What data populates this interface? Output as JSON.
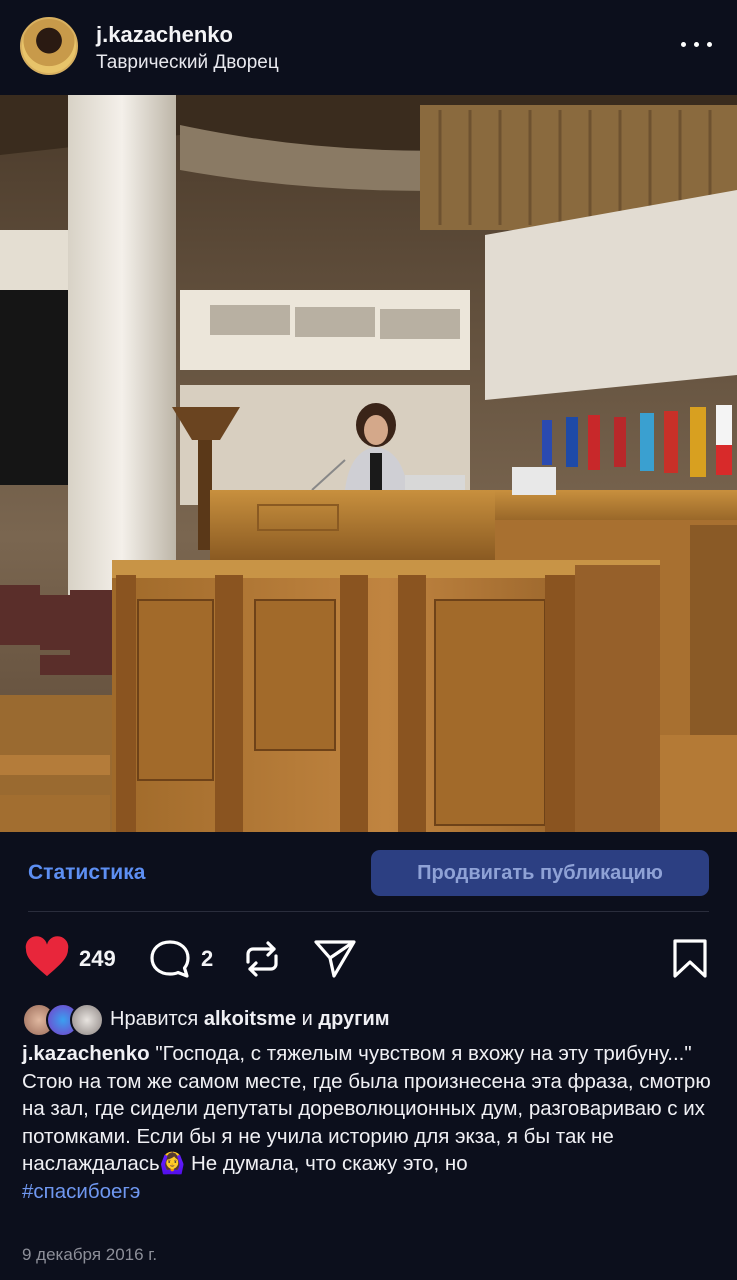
{
  "header": {
    "username": "j.kazachenko",
    "location": "Таврический Дворец",
    "avatar_icon": "profile-photo",
    "more_icon": "more-dots-icon"
  },
  "post_image": {
    "icon": "photo-podium-in-hall"
  },
  "stats": {
    "statistics_label": "Статистика",
    "promote_label": "Продвигать публикацию"
  },
  "actions": {
    "like_count": "249",
    "comment_count": "2",
    "like_color": "#e8263b"
  },
  "likes": {
    "prefix": "Нравится",
    "user": "alkoitsme",
    "middle": "и",
    "others": "другим"
  },
  "caption": {
    "username": "j.kazachenko",
    "text": "\"Господа, с тяжелым чувством я вхожу на эту трибуну...\" Стою на том же самом месте, где была произнесена эта фраза, смотрю на зал, где сидели депутаты дореволюционных дум, разговариваю с их потомками. Если бы я не учила историю для экза, я бы так не наслаждалась",
    "emoji": "🙆‍♀️",
    "text_after": " Не думала, что скажу это, но",
    "hashtag": "#спасибоегэ"
  },
  "date": "9 декабря 2016 г.",
  "colors": {
    "background": "#0c0f1c",
    "accent": "#5d8ff3",
    "promote_bg": "#2c3f82"
  }
}
